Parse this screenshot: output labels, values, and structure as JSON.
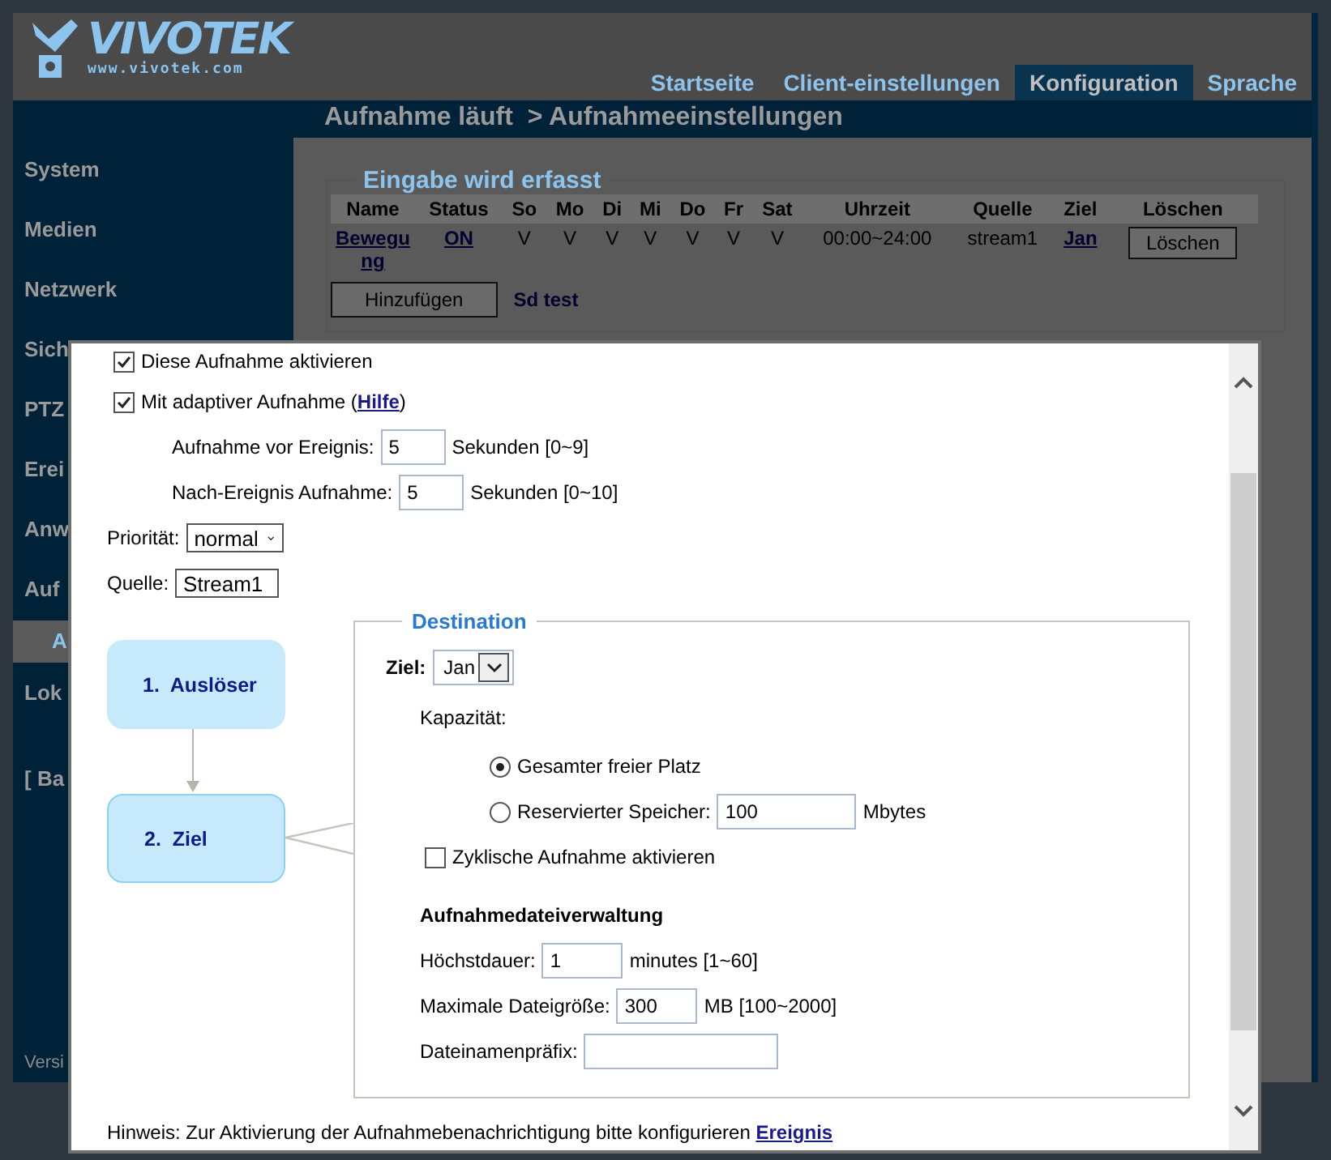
{
  "logo": {
    "name": "VIVOTEK",
    "url": "www.vivotek.com"
  },
  "tabs": [
    {
      "label": "Startseite",
      "selected": false
    },
    {
      "label": "Client-einstellungen",
      "selected": false
    },
    {
      "label": "Konfiguration",
      "selected": true
    },
    {
      "label": "Sprache",
      "selected": false
    }
  ],
  "breadcrumb": "Aufnahme läuft  > Aufnahmeeinstellungen",
  "sidebar": {
    "items": [
      {
        "label": "System",
        "selected": false,
        "kind": "main"
      },
      {
        "label": "Medien",
        "selected": false,
        "kind": "main"
      },
      {
        "label": "Netzwerk",
        "selected": false,
        "kind": "main"
      },
      {
        "label": "Sich",
        "selected": false,
        "kind": "main"
      },
      {
        "label": "PTZ",
        "selected": false,
        "kind": "main"
      },
      {
        "label": "Erei",
        "selected": false,
        "kind": "main"
      },
      {
        "label": "Anw",
        "selected": false,
        "kind": "main"
      },
      {
        "label": "Auf",
        "selected": false,
        "kind": "main"
      },
      {
        "label": "A",
        "selected": true,
        "kind": "sub"
      },
      {
        "label": "Lok",
        "selected": false,
        "kind": "main"
      },
      {
        "label": "[ Ba",
        "selected": false,
        "kind": "mode"
      }
    ],
    "version": "Versi"
  },
  "recordings": {
    "legend": "Eingabe wird erfasst",
    "columns": [
      "Name",
      "Status",
      "So",
      "Mo",
      "Di",
      "Mi",
      "Do",
      "Fr",
      "Sat",
      "Uhrzeit",
      "Quelle",
      "Ziel",
      "Löschen"
    ],
    "rows": [
      {
        "name": "Bewegung",
        "status": "ON",
        "days": [
          "V",
          "V",
          "V",
          "V",
          "V",
          "V",
          "V"
        ],
        "time": "00:00~24:00",
        "source": "stream1",
        "destination": "Jan",
        "delete": "Löschen"
      }
    ],
    "add_button": "Hinzufügen",
    "storage": "Sd test"
  },
  "dialog": {
    "enable": {
      "label": "Diese Aufnahme aktivieren",
      "checked": true
    },
    "adaptive": {
      "label": "Mit adaptiver Aufnahme (",
      "link": "Hilfe",
      "suffix": ")",
      "checked": true
    },
    "pre_event": {
      "label": "Aufnahme vor Ereignis:",
      "value": "5",
      "unit": "Sekunden [0~9]"
    },
    "post_event": {
      "label": "Nach-Ereignis Aufnahme:",
      "value": "5",
      "unit": "Sekunden [0~10]"
    },
    "priority": {
      "label": "Priorität:",
      "value": "normal"
    },
    "source": {
      "label": "Quelle:",
      "value": "Stream1"
    },
    "steps": [
      {
        "label": "1.  Auslöser",
        "selected": false
      },
      {
        "label": "2.  Ziel",
        "selected": true
      }
    ],
    "destination": {
      "legend": "Destination",
      "target_label": "Ziel:",
      "target_value": "Jan",
      "capacity_label": "Kapazität:",
      "capacity_options": [
        {
          "label": "Gesamter freier Platz",
          "selected": true
        },
        {
          "label": "Reservierter Speicher:",
          "selected": false,
          "value": "100",
          "unit": "Mbytes"
        }
      ],
      "cyclic": {
        "label": "Zyklische Aufnahme aktivieren",
        "checked": false
      },
      "file_title": "Aufnahmedateiverwaltung",
      "fields": [
        {
          "label": "Höchstdauer:",
          "value": "1",
          "unit": "minutes [1~60]"
        },
        {
          "label": "Maximale Dateigröße:",
          "value": "300",
          "unit": "MB [100~2000]"
        },
        {
          "label": "Dateinamenpräfix:"
        }
      ]
    },
    "hint": {
      "text": "Hinweis: Zur Aktivierung der Aufnahmebenachrichtigung bitte konfigurieren",
      "link": "Ereignis"
    }
  }
}
